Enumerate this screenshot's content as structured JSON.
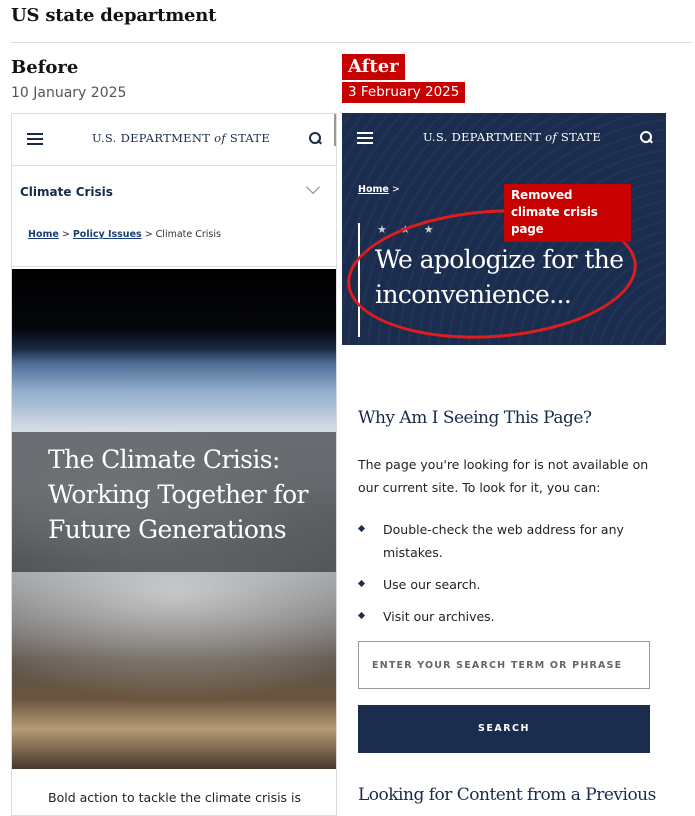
{
  "page": {
    "title": "US state department"
  },
  "before": {
    "heading": "Before",
    "date": "10 January 2025",
    "site": {
      "dept_pre": "U.S. DEPARTMENT ",
      "dept_of": "of",
      "dept_post": " STATE"
    },
    "section_label": "Climate Crisis",
    "breadcrumb": {
      "home": "Home",
      "sep1": " > ",
      "policy": "Policy Issues",
      "sep2": " > ",
      "current": "Climate Crisis"
    },
    "hero_title": "The Climate Crisis: Working Together for Future Generations",
    "body_text": "Bold action to tackle the climate crisis is"
  },
  "after": {
    "heading": "After",
    "date": "3 February 2025",
    "site": {
      "dept_pre": "U.S. DEPARTMENT ",
      "dept_of": "of",
      "dept_post": " STATE"
    },
    "breadcrumb": {
      "home": "Home",
      "sep": " >"
    },
    "stars": "★ ★ ★",
    "apology": "We apologize for the inconvenience...",
    "annotation": "Removed climate crisis page",
    "why_heading": "Why Am I Seeing This Page?",
    "paragraph": "The page you're looking for is not available on our current site. To look for it, you can:",
    "bullets": [
      "Double-check the web address for any mistakes.",
      "Use our search.",
      "Visit our archives."
    ],
    "search_placeholder": "ENTER YOUR SEARCH TERM OR PHRASE",
    "search_button": "SEARCH",
    "looking_heading": "Looking for Content from a Previous"
  },
  "colors": {
    "accent_red": "#c70000",
    "navy": "#1a2d4f"
  },
  "icons": [
    "hamburger-icon",
    "search-icon",
    "chevron-down-icon",
    "diamond-bullet-icon"
  ]
}
